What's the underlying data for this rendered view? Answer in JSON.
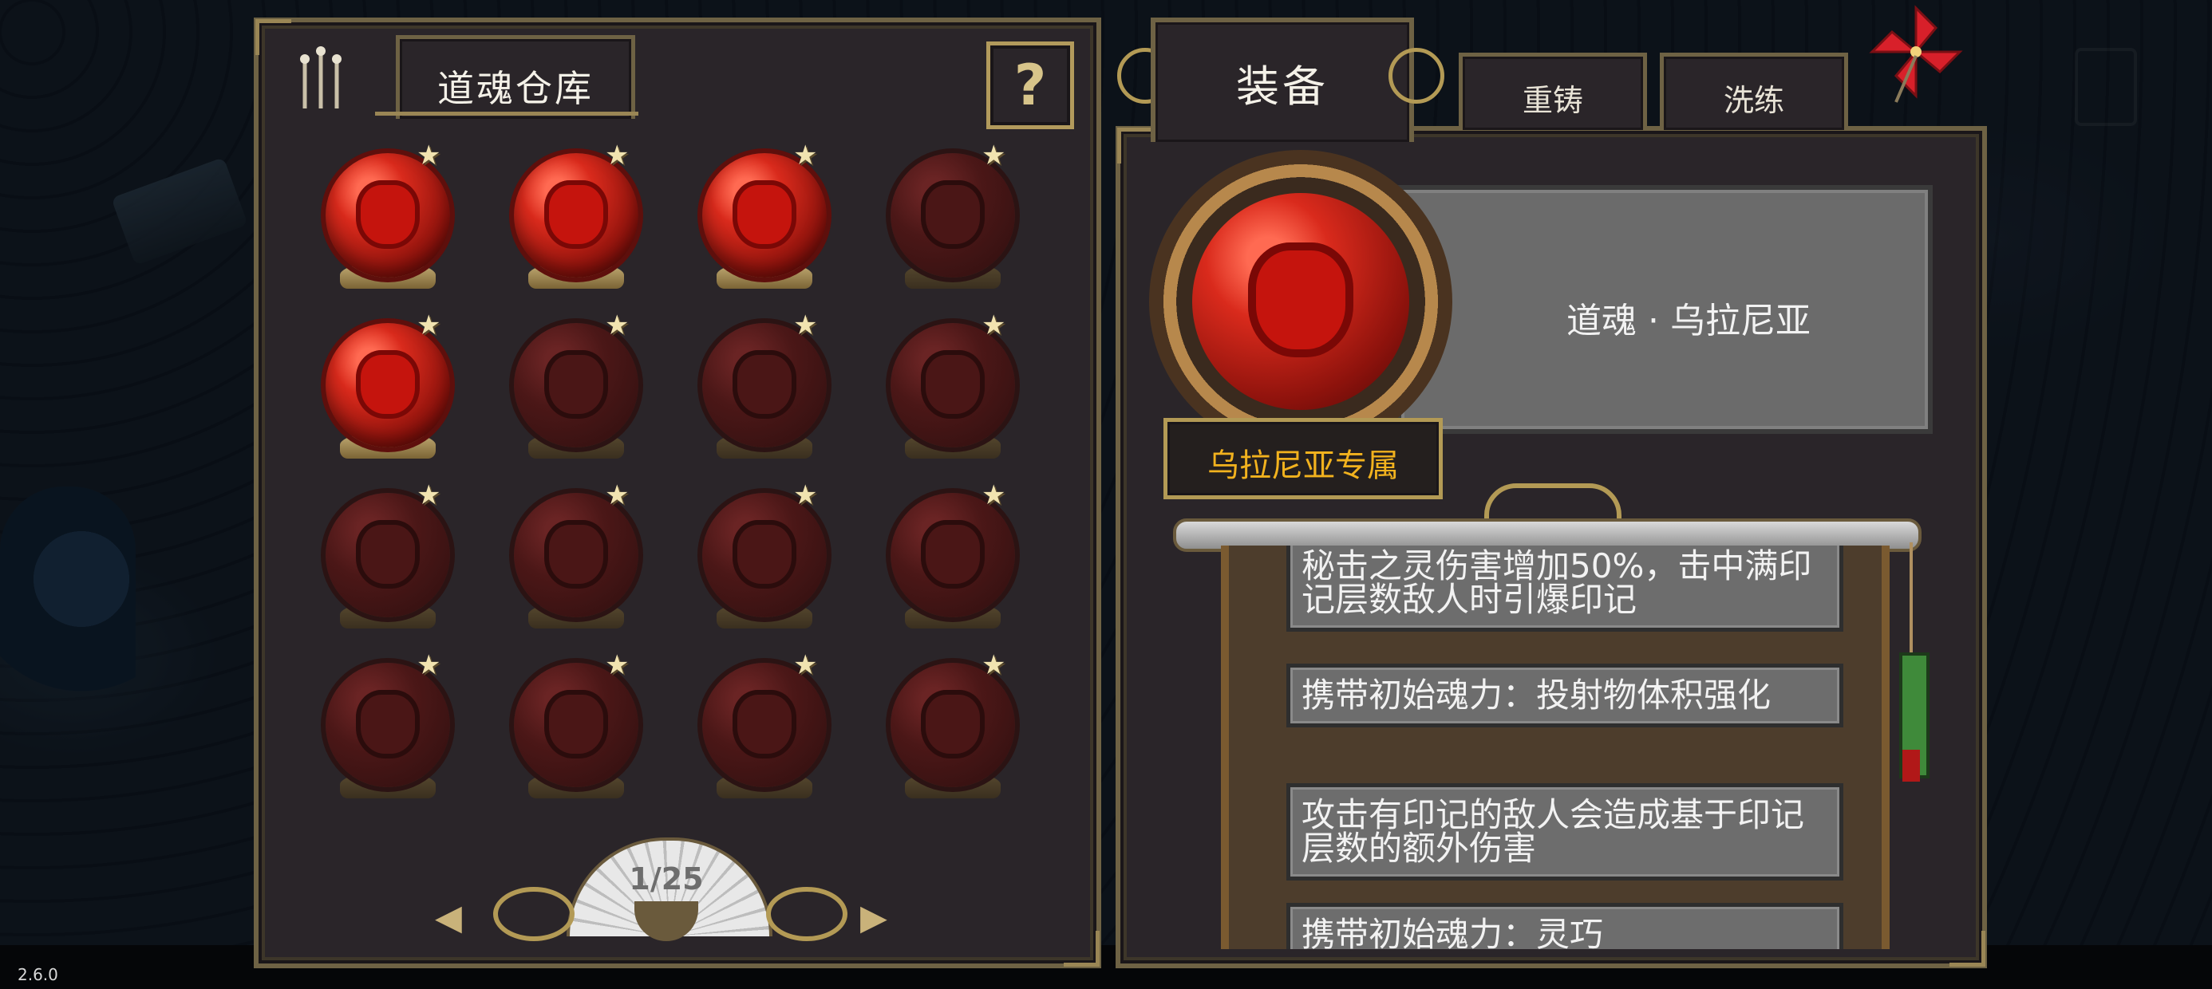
{
  "version": "2.6.0",
  "warehouse": {
    "title": "道魂仓库",
    "help_label": "?",
    "page_indicator": "1/25",
    "prev_arrow": "◀",
    "next_arrow": "▶",
    "star_glyph": "★",
    "slots": [
      {
        "state": "unlocked"
      },
      {
        "state": "unlocked"
      },
      {
        "state": "unlocked"
      },
      {
        "state": "locked"
      },
      {
        "state": "unlocked"
      },
      {
        "state": "locked"
      },
      {
        "state": "locked"
      },
      {
        "state": "locked"
      },
      {
        "state": "locked"
      },
      {
        "state": "locked"
      },
      {
        "state": "locked"
      },
      {
        "state": "locked"
      },
      {
        "state": "locked"
      },
      {
        "state": "locked"
      },
      {
        "state": "locked"
      },
      {
        "state": "locked"
      }
    ]
  },
  "tabs": {
    "equip": "装备",
    "recast": "重铸",
    "refine": "洗练"
  },
  "detail": {
    "name": "道魂 · 乌拉尼亚",
    "exclusive": "乌拉尼亚专属",
    "effects": [
      "秘击之灵伤害增加50%，击中满印记层数敌人时引爆印记",
      "携带初始魂力：投射物体积强化",
      "攻击有印记的敌人会造成基于印记层数的额外伤害",
      "携带初始魂力：灵巧"
    ]
  },
  "colors": {
    "panel_bg": "#2a2529",
    "gold_border": "#b39a55",
    "exclusive_text": "#f2b21e",
    "orb_red": "#d92a1c"
  },
  "icons": {
    "close": "pinwheel-icon",
    "help": "question-icon",
    "spirit": "spirit-icon"
  }
}
